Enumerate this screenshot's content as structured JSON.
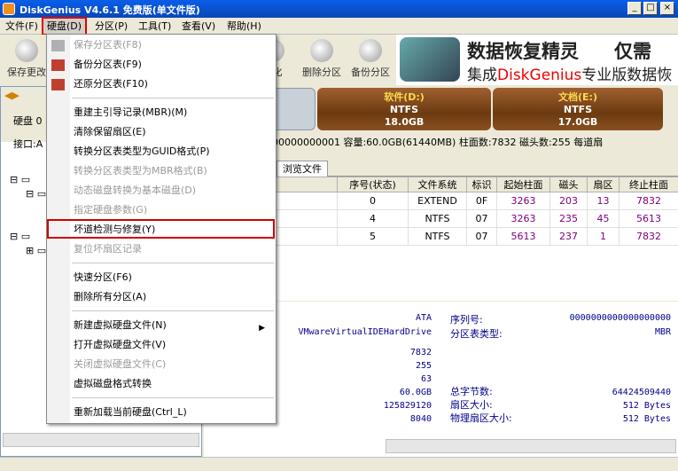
{
  "window": {
    "title": "DiskGenius V4.6.1 免费版(单文件版)"
  },
  "menu": {
    "items": [
      {
        "label": "文件(F)"
      },
      {
        "label": "硬盘(D)"
      },
      {
        "label": "分区(P)"
      },
      {
        "label": "工具(T)"
      },
      {
        "label": "查看(V)"
      },
      {
        "label": "帮助(H)"
      }
    ]
  },
  "toolbar": {
    "save_label": "保存更改",
    "format_label": "格式化",
    "delete_label": "删除分区",
    "backup_label": "备份分区"
  },
  "banner": {
    "line1": "数据恢复精灵",
    "line1_tail": "仅需",
    "line2_pre": "集成",
    "line2_red": "DiskGenius",
    "line2_post": "专业版数据恢"
  },
  "left": {
    "disk_label": "硬盘 0",
    "iface_label": "接口:A"
  },
  "diskbar": {
    "partitions": [
      {
        "name": "软件(D:)",
        "fs": "NTFS",
        "size": "18.0GB"
      },
      {
        "name": "文档(E:)",
        "fs": "NTFS",
        "size": "17.0GB"
      }
    ]
  },
  "infobar": {
    "text": "0000000000000000000001  容量:60.0GB(61440MB)  柱面数:7832  磁头数:255  每道扇"
  },
  "tab": {
    "label": "浏览文件"
  },
  "table": {
    "headers": [
      "",
      "序号(状态)",
      "文件系统",
      "标识",
      "起始柱面",
      "磁头",
      "扇区",
      "终止柱面"
    ],
    "rows": [
      [
        "区",
        "0",
        "EXTEND",
        "0F",
        "3263",
        "203",
        "13",
        "7832"
      ],
      [
        "(D:)",
        "4",
        "NTFS",
        "07",
        "3263",
        "235",
        "45",
        "5613"
      ],
      [
        "(E:)",
        "5",
        "NTFS",
        "07",
        "5613",
        "237",
        "1",
        "7832"
      ]
    ]
  },
  "details": {
    "ata": "ATA",
    "model": "VMwareVirtualIDEHardDrive",
    "serial_label": "序列号:",
    "serial_value": "0000000000000000000",
    "pt_label": "分区表类型:",
    "pt_value": "MBR",
    "cyl": "7832",
    "heads": "255",
    "sectors": "63",
    "capacity": "60.0GB",
    "total_bytes_label": "总字节数:",
    "total_bytes_value": "64424509440",
    "total_sectors": "125829120",
    "sector_size_label": "扇区大小:",
    "sector_size_value": "512 Bytes",
    "extra": "8040",
    "phys_sector_label": "物理扇区大小:",
    "phys_sector_value": "512 Bytes"
  },
  "dropdown": {
    "items": [
      {
        "label": "保存分区表(F8)",
        "disabled": true
      },
      {
        "label": "备份分区表(F9)",
        "disabled": false
      },
      {
        "label": "还原分区表(F10)",
        "disabled": false
      },
      {
        "label": "重建主引导记录(MBR)(M)",
        "disabled": false
      },
      {
        "label": "清除保留扇区(E)",
        "disabled": false
      },
      {
        "label": "转换分区表类型为GUID格式(P)",
        "disabled": false
      },
      {
        "label": "转换分区表类型为MBR格式(B)",
        "disabled": true
      },
      {
        "label": "动态磁盘转换为基本磁盘(D)",
        "disabled": true
      },
      {
        "label": "指定硬盘参数(G)",
        "disabled": true
      },
      {
        "label": "坏道检测与修复(Y)",
        "disabled": false
      },
      {
        "label": "复位坏扇区记录",
        "disabled": true
      },
      {
        "label": "快速分区(F6)",
        "disabled": false
      },
      {
        "label": "删除所有分区(A)",
        "disabled": false
      },
      {
        "label": "新建虚拟硬盘文件(N)",
        "disabled": false
      },
      {
        "label": "打开虚拟硬盘文件(V)",
        "disabled": false
      },
      {
        "label": "关闭虚拟硬盘文件(C)",
        "disabled": true
      },
      {
        "label": "虚拟磁盘格式转换",
        "disabled": false
      },
      {
        "label": "重新加载当前硬盘(Ctrl_L)",
        "disabled": false
      }
    ]
  },
  "colors": {
    "highlight": "#d00000",
    "title_blue": "#0a5ee8",
    "partition_brown": "#8a5020"
  }
}
